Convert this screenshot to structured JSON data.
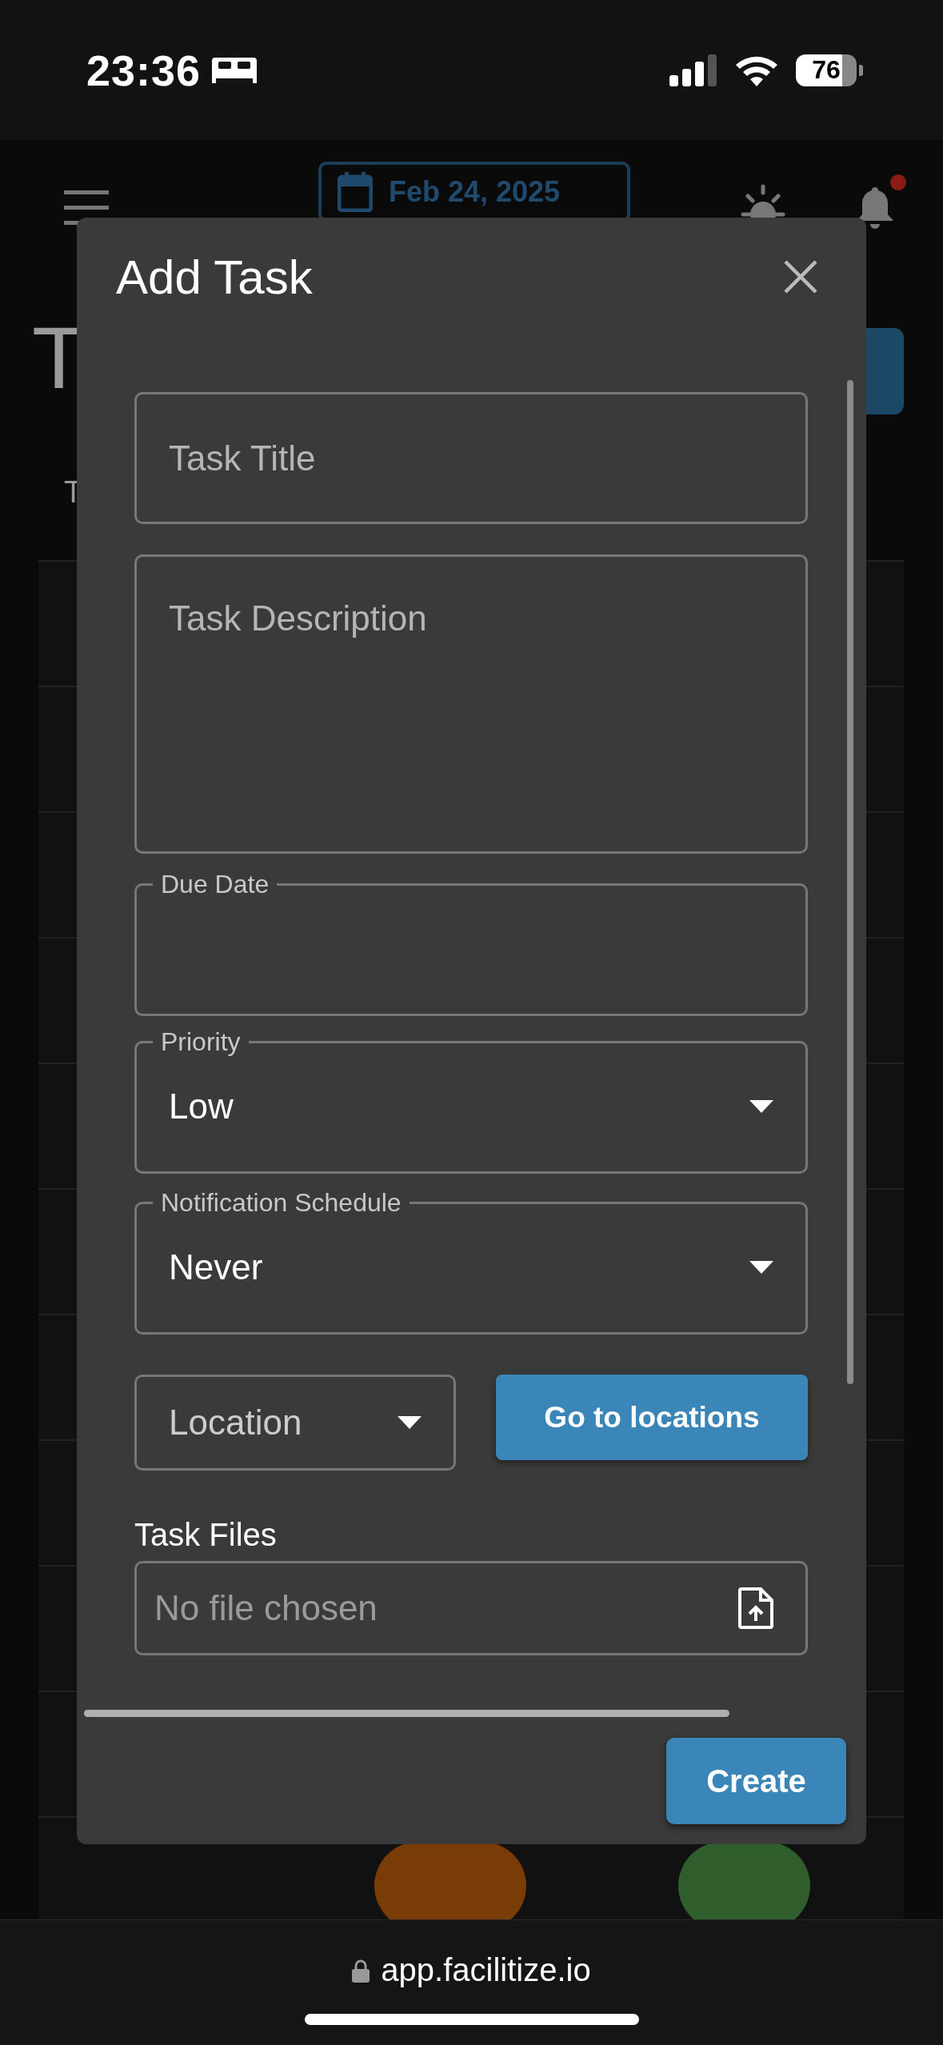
{
  "status_bar": {
    "time": "23:36",
    "battery": "76"
  },
  "header": {
    "date": "Feb 24, 2025",
    "has_notification": true
  },
  "page": {
    "title": "T",
    "column_header": "T",
    "rows": [
      {
        "pills": []
      },
      {
        "pills": []
      },
      {
        "pills": []
      },
      {
        "pills": []
      },
      {
        "pills": []
      },
      {
        "pills": []
      },
      {
        "pills": []
      },
      {
        "pills": []
      },
      {
        "pills": []
      },
      {
        "pills": []
      },
      {
        "pills": [
          {
            "color": "#7a3c06"
          },
          {
            "color": "#2f5e2c"
          }
        ]
      }
    ]
  },
  "modal": {
    "title": "Add Task",
    "fields": [
      {
        "kind": "text",
        "placeholder": "Task Title"
      },
      {
        "kind": "textarea",
        "placeholder": "Task Description"
      },
      {
        "kind": "date",
        "label": "Due Date"
      },
      {
        "kind": "select",
        "label": "Priority",
        "value": "Low"
      },
      {
        "kind": "select",
        "label": "Notification Schedule",
        "value": "Never"
      }
    ],
    "location": {
      "placeholder": "Location"
    },
    "locations_button": "Go to locations",
    "files": {
      "label": "Task Files",
      "placeholder": "No file chosen"
    },
    "create_button": "Create"
  },
  "browser": {
    "url": "app.facilitize.io"
  }
}
